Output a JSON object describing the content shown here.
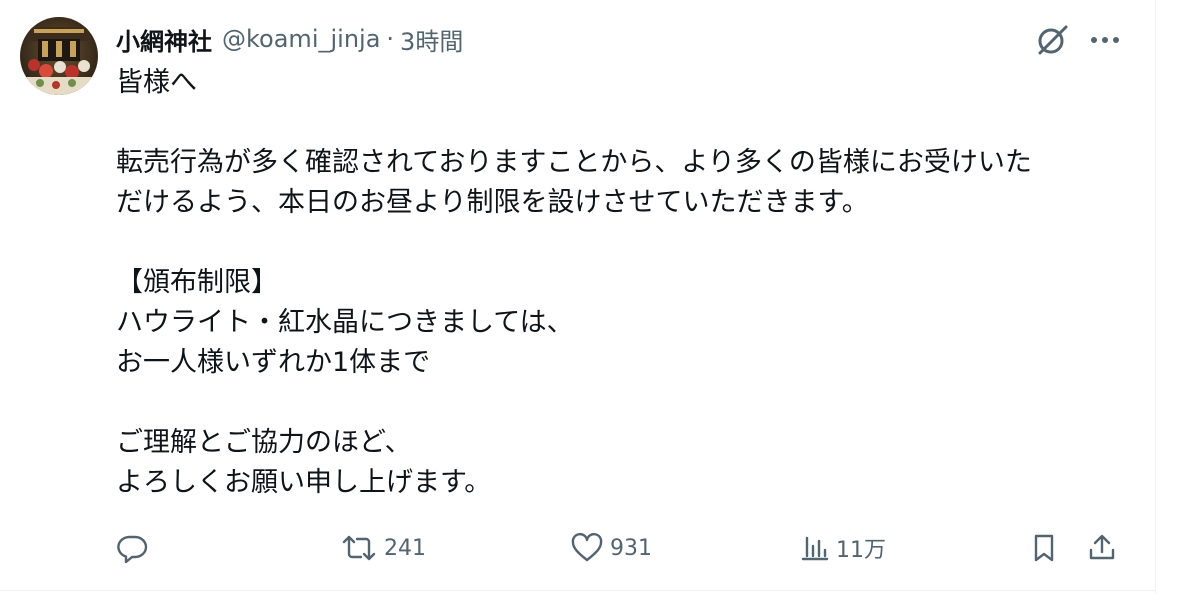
{
  "tweet": {
    "author": {
      "display_name": "小網神社",
      "handle": "@koami_jinja",
      "avatar_icon": "shrine-photo-avatar"
    },
    "separator": "·",
    "time": "3時間",
    "body_lines": [
      "皆様へ",
      "",
      "転売行為が多く確認されておりますことから、より多くの皆様にお受けいた",
      "だけるよう、本日のお昼より制限を設けさせていただきます。",
      "",
      "【頒布制限】",
      "ハウライト・紅水晶につきましては、",
      "お一人様いずれか1体まで",
      "",
      "ご理解とご協力のほど、",
      "よろしくお願い申し上げます。"
    ],
    "actions": {
      "reply": {
        "icon": "reply-icon",
        "count": ""
      },
      "repost": {
        "icon": "repost-icon",
        "count": "241"
      },
      "like": {
        "icon": "heart-icon",
        "count": "931"
      },
      "views": {
        "icon": "views-icon",
        "count": "11万"
      },
      "bookmark": {
        "icon": "bookmark-icon"
      },
      "share": {
        "icon": "share-icon"
      }
    },
    "header_icons": {
      "grok": "grok-icon",
      "more": "more-icon"
    }
  },
  "colors": {
    "text_primary": "#0f1419",
    "text_secondary": "#536471",
    "divider": "#eff3f4"
  }
}
